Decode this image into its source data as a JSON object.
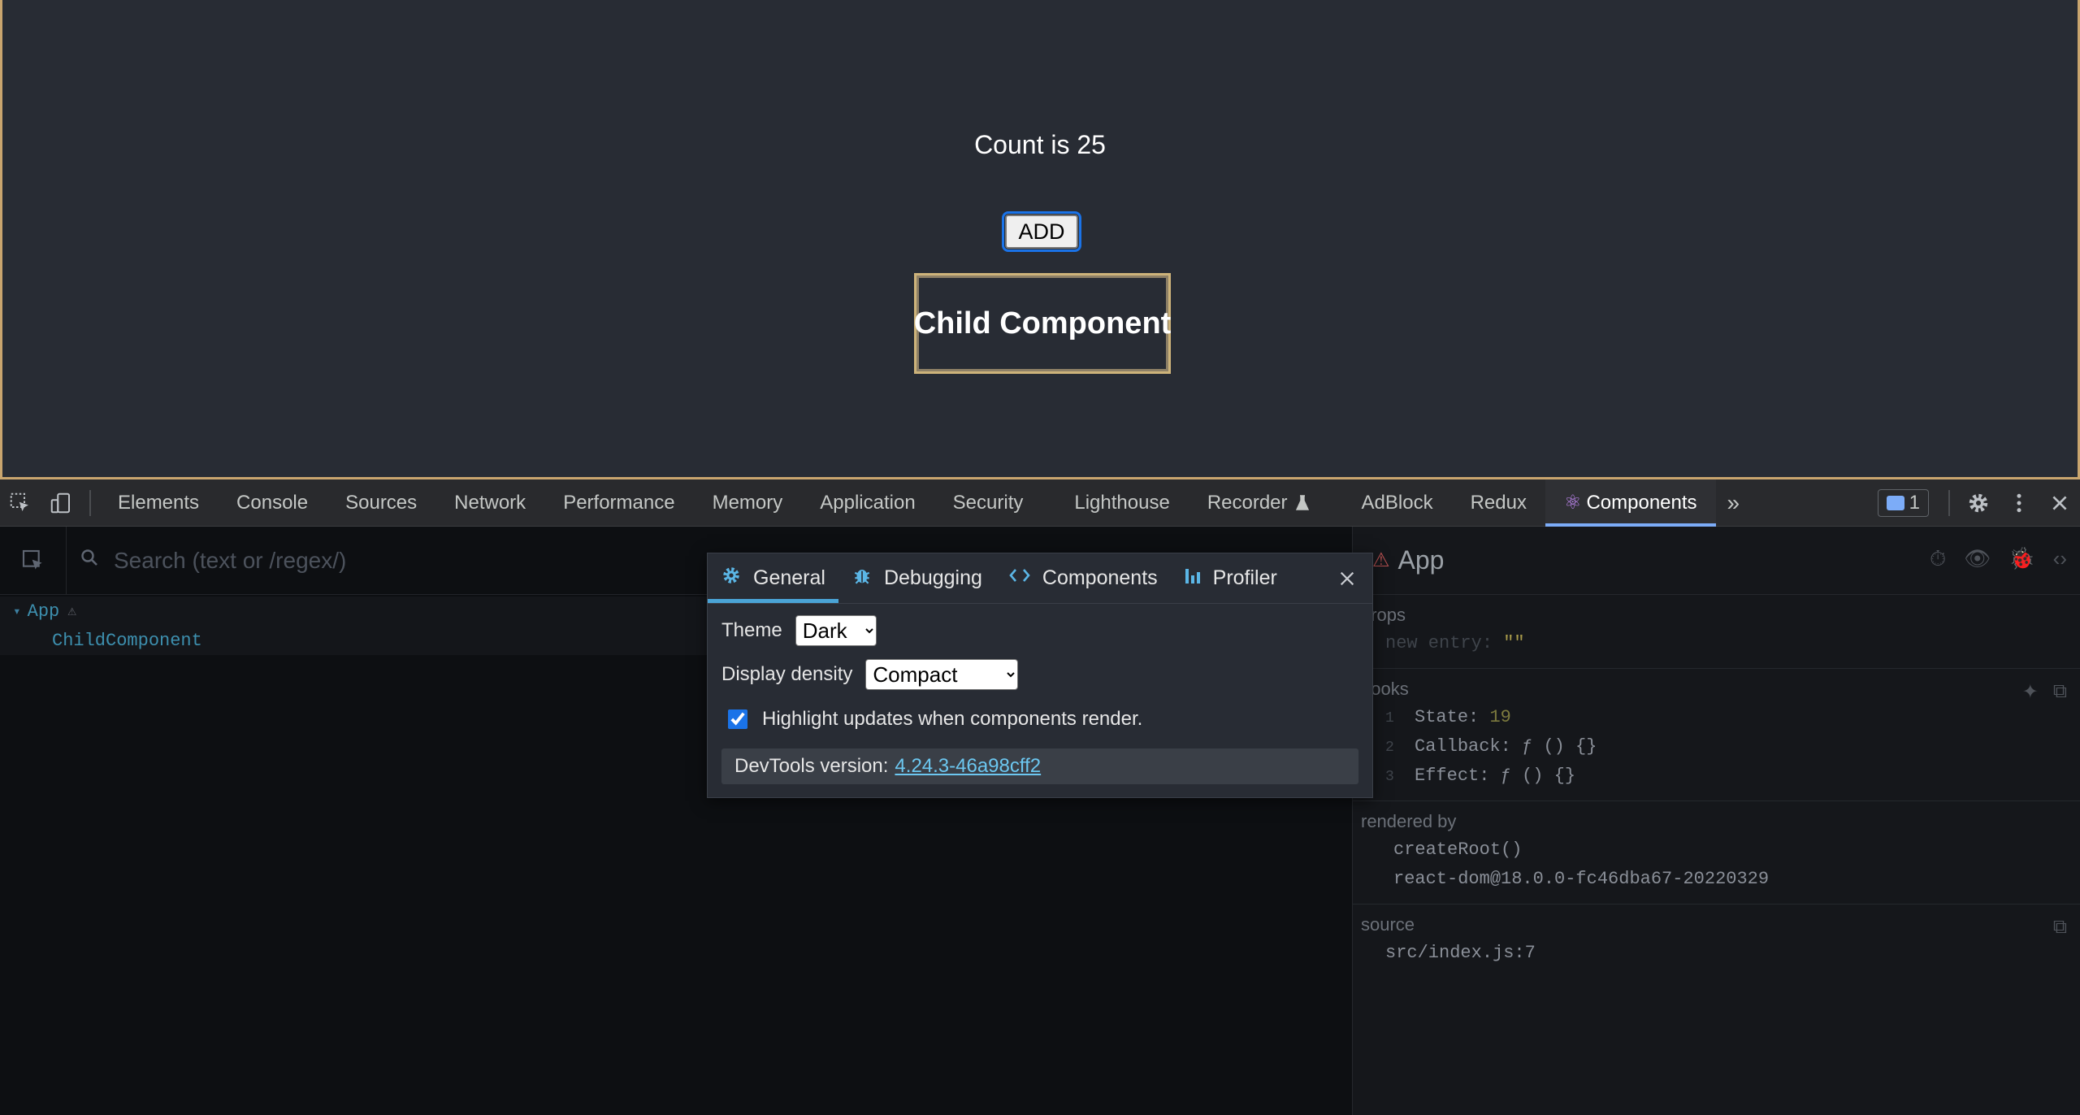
{
  "app": {
    "count_text": "Count is 25",
    "add_label": "ADD",
    "child_label": "Child Component"
  },
  "devtools_tabs": [
    {
      "label": "Elements"
    },
    {
      "label": "Console"
    },
    {
      "label": "Sources"
    },
    {
      "label": "Network"
    },
    {
      "label": "Performance"
    },
    {
      "label": "Memory"
    },
    {
      "label": "Application"
    },
    {
      "label": "Security"
    },
    {
      "label": "Lighthouse"
    },
    {
      "label": "Recorder"
    },
    {
      "label": "AdBlock"
    },
    {
      "label": "Redux"
    },
    {
      "label": "Components"
    }
  ],
  "issues_count": "1",
  "tree": {
    "search_placeholder": "Search (text or /regex/)",
    "items": [
      {
        "label": "App"
      },
      {
        "label": "ChildComponent"
      }
    ]
  },
  "side": {
    "title": "App",
    "props_label": "props",
    "props": [
      {
        "key": "new entry",
        "value": "\"\""
      }
    ],
    "hooks_label": "hooks",
    "hooks": [
      {
        "index": "1",
        "name": "State:",
        "value": "19"
      },
      {
        "index": "2",
        "name": "Callback:",
        "value": "ƒ () {}"
      },
      {
        "index": "3",
        "name": "Effect:",
        "value": "ƒ () {}"
      }
    ],
    "rendered_by_label": "rendered by",
    "rendered_by": [
      "createRoot()",
      "react-dom@18.0.0-fc46dba67-20220329"
    ],
    "source_label": "source",
    "source_value": "src/index.js:7"
  },
  "settings": {
    "tabs": [
      {
        "label": "General",
        "icon": "gear-icon"
      },
      {
        "label": "Debugging",
        "icon": "bug-icon"
      },
      {
        "label": "Components",
        "icon": "code-icon"
      },
      {
        "label": "Profiler",
        "icon": "bar-chart-icon"
      }
    ],
    "theme_label": "Theme",
    "theme_value": "Dark",
    "density_label": "Display density",
    "density_value": "Compact",
    "highlight_label": "Highlight updates when components render.",
    "highlight_checked": true,
    "version_label": "DevTools version:",
    "version_value": "4.24.3-46a98cff2"
  },
  "colors": {
    "app_bg": "#282c34",
    "active_tab_underline": "#7cacf8",
    "link": "#6cc7f0"
  }
}
